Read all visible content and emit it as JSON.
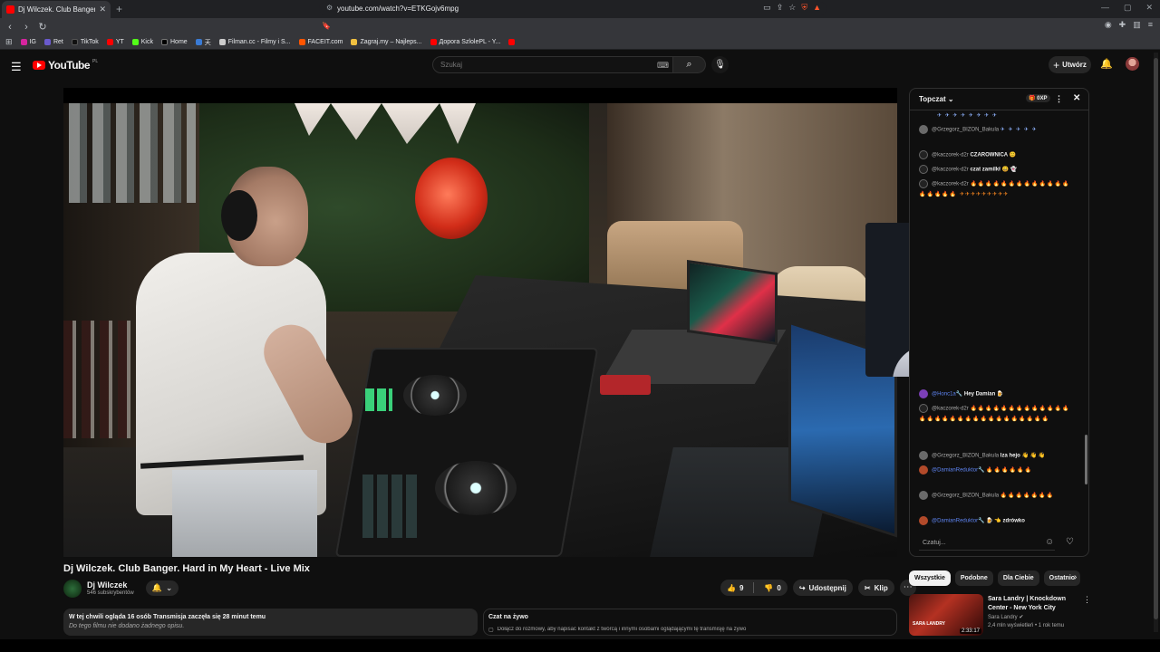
{
  "browser": {
    "tab_title": "Dj Wilczek. Club Banger. Hard",
    "url": "youtube.com/watch?v=ETKGojv6mpg",
    "bookmarks": [
      {
        "label": "IG",
        "color": "#d6249f"
      },
      {
        "label": "Ret",
        "color": "#6a5acd"
      },
      {
        "label": "TikTok",
        "color": "#111111"
      },
      {
        "label": "YT",
        "color": "#ff0000"
      },
      {
        "label": "Kick",
        "color": "#53fc18"
      },
      {
        "label": "Home",
        "color": "#000000"
      },
      {
        "label": "天",
        "color": "#3a7bd5"
      },
      {
        "label": "Filman.cc - Filmy i S...",
        "color": "#cccccc"
      },
      {
        "label": "FACEIT.com",
        "color": "#ff5500"
      },
      {
        "label": "Zagraj.my – Najleps...",
        "color": "#f0c040"
      },
      {
        "label": "Дорога SzlolePL - Y...",
        "color": "#ff0000"
      },
      {
        "label": "",
        "color": "#ff0000"
      }
    ]
  },
  "youtube": {
    "logo_text": "YouTube",
    "logo_country": "PL",
    "search_placeholder": "Szukaj",
    "create_label": "Utwórz"
  },
  "video": {
    "title": "Dj Wilczek. Club Banger. Hard in My Heart - Live Mix",
    "channel_name": "Dj Wilczek",
    "subscribers": "546 subskrybentów",
    "likes": "9",
    "dislikes": "0",
    "share_label": "Udostępnij",
    "clip_label": "Klip"
  },
  "description": {
    "line1": "W tej chwili ogląda 16 osób  Transmisja zaczęła się 28 minut temu",
    "line2": "Do tego filmu nie dodano żadnego opisu."
  },
  "live_panel": {
    "title": "Czat na żywo",
    "text": "Dołącz do rozmowy, aby napisać kontakt z twórcą i innymi osobami oglądającymi tę transmisję na żywo"
  },
  "chat": {
    "header": "Topczat",
    "xp_label": "0XP",
    "input_placeholder": "Czatuj...",
    "messages": [
      {
        "author": "",
        "text": "✈ ✈ ✈ ✈ ✈ ✈ ✈ ✈",
        "top_emo": true
      },
      {
        "author": "@Grzegorz_BIZON_Bakula",
        "text": "✈ ✈ ✈ ✈ ✈"
      },
      {
        "author": "@kaczorek-d2r",
        "text": "CZAROWNICA 😊"
      },
      {
        "author": "@kaczorek-d2r",
        "text": "czat zamilkł 😄 👻"
      },
      {
        "author": "@kaczorek-d2r",
        "text": "🔥🔥🔥🔥🔥🔥🔥🔥🔥🔥🔥🔥🔥🔥🔥🔥🔥🔥 ✈✈✈✈✈✈✈✈✈"
      },
      {
        "author": "@Honc1a🔧",
        "text": "Hey Damian 🍺"
      },
      {
        "author": "@kaczorek-d2r",
        "text": "🔥🔥🔥🔥🔥🔥🔥🔥🔥🔥🔥🔥🔥🔥🔥🔥🔥🔥🔥🔥🔥🔥🔥🔥🔥🔥🔥🔥🔥🔥"
      },
      {
        "author": "@Grzegorz_BIZON_Bakula",
        "text": "Iza hejo 👋 👋 👋"
      },
      {
        "author": "@DamianReduktor🔧",
        "text": "🔥🔥🔥🔥🔥🔥"
      },
      {
        "author": "@Grzegorz_BIZON_Bakula",
        "text": "🔥🔥🔥🔥🔥🔥🔥"
      },
      {
        "author": "@DamianReduktor🔧",
        "text": "🍺 👈 zdrówko"
      }
    ]
  },
  "related": {
    "chips": [
      "Wszystkie",
      "Podobne",
      "Dla Ciebie",
      "Ostatnio"
    ],
    "items": [
      {
        "title": "Sara Landry | Knockdown Center - New York City",
        "channel": "Sara Landry",
        "meta": "2,4 mln wyświetleń • 1 rok temu",
        "duration": "2:33:17",
        "thumb_text": "SARA LANDRY"
      }
    ]
  },
  "colors": {
    "accent": "#ff0000",
    "background": "#0f0f0f",
    "chat_mod": "#5e84f1"
  }
}
